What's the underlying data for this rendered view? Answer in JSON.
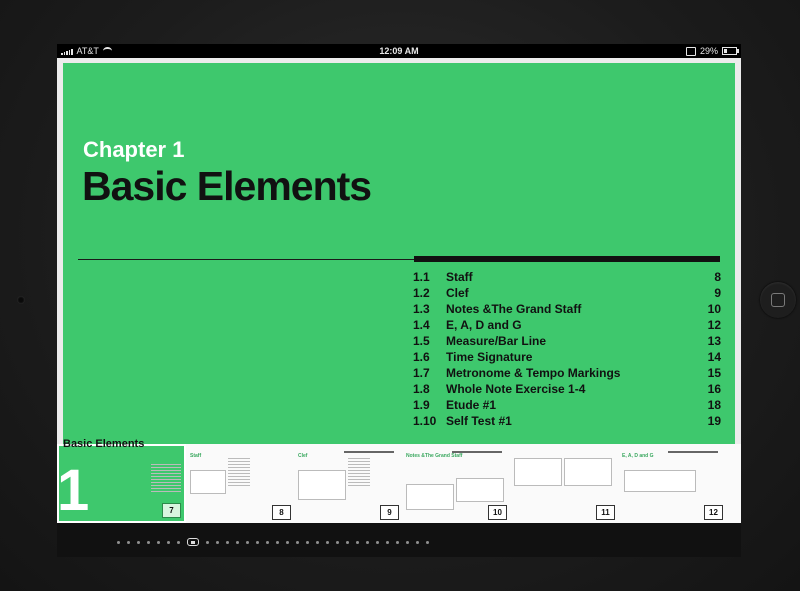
{
  "status_bar": {
    "carrier": "AT&T",
    "time": "12:09 AM",
    "battery": "29%",
    "battery_level": 0.29
  },
  "page": {
    "chapter_label": "Chapter 1",
    "chapter_title": "Basic Elements",
    "accent_color": "#3ec86d",
    "toc": [
      {
        "num": "1.1",
        "title": "Staff",
        "page": "8"
      },
      {
        "num": "1.2",
        "title": "Clef",
        "page": "9"
      },
      {
        "num": "1.3",
        "title": "Notes &The Grand Staff",
        "page": "10"
      },
      {
        "num": "1.4",
        "title": "E, A, D and G",
        "page": "12"
      },
      {
        "num": "1.5",
        "title": "Measure/Bar Line",
        "page": "13"
      },
      {
        "num": "1.6",
        "title": "Time Signature",
        "page": "14"
      },
      {
        "num": "1.7",
        "title": "Metronome & Tempo Markings",
        "page": "15"
      },
      {
        "num": "1.8",
        "title": "Whole Note Exercise 1-4",
        "page": "16"
      },
      {
        "num": "1.9",
        "title": "Etude #1",
        "page": "18"
      },
      {
        "num": "1.10",
        "title": "Self Test #1",
        "page": "19"
      }
    ]
  },
  "filmstrip": {
    "active": {
      "title": "Basic Elements",
      "big_number": "1",
      "page": "7"
    },
    "thumbs": [
      {
        "title": "Staff",
        "page": "8"
      },
      {
        "title": "Clef",
        "page": "9"
      },
      {
        "title": "Notes &The Grand Staff",
        "page": "10"
      },
      {
        "title": "",
        "page": "11"
      },
      {
        "title": "E, A, D and G",
        "page": "12"
      }
    ]
  },
  "page_dots": {
    "count": 31,
    "active_index": 7
  }
}
